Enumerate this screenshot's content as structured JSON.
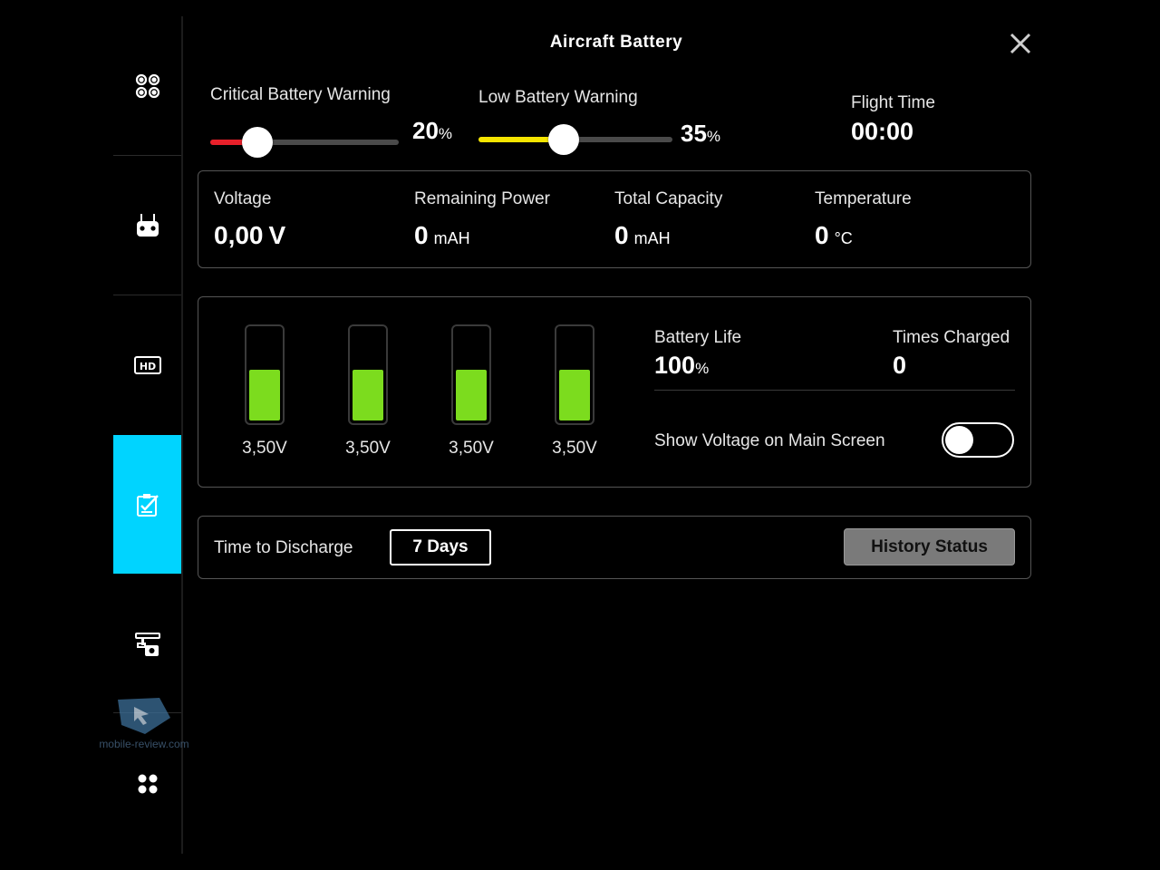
{
  "title": "Aircraft Battery",
  "sidebar": {
    "items": [
      {
        "icon": "aircraft-icon",
        "active": false
      },
      {
        "icon": "remote-controller-icon",
        "active": false
      },
      {
        "icon": "hd-icon",
        "active": false
      },
      {
        "icon": "battery-checklist-icon",
        "active": true
      },
      {
        "icon": "gimbal-camera-icon",
        "active": false
      },
      {
        "icon": "more-dots-icon",
        "active": false
      }
    ],
    "active_color": "#00d4ff"
  },
  "critical_warning": {
    "label": "Critical Battery Warning",
    "value": "20",
    "unit": "%",
    "level": 0.2,
    "color": "#e8202a"
  },
  "low_warning": {
    "label": "Low Battery Warning",
    "value": "35",
    "unit": "%",
    "level": 0.35,
    "color": "#f5e500"
  },
  "flight_time": {
    "label": "Flight Time",
    "value": "00:00"
  },
  "stats": {
    "voltage": {
      "label": "Voltage",
      "value": "0,00",
      "unit": "V"
    },
    "remaining_power": {
      "label": "Remaining Power",
      "value": "0",
      "unit": "mAH"
    },
    "total_capacity": {
      "label": "Total Capacity",
      "value": "0",
      "unit": "mAH"
    },
    "temperature": {
      "label": "Temperature",
      "value": "0",
      "unit": "°C"
    }
  },
  "cells": [
    {
      "voltage": "3,50V",
      "level": 0.55
    },
    {
      "voltage": "3,50V",
      "level": 0.55
    },
    {
      "voltage": "3,50V",
      "level": 0.55
    },
    {
      "voltage": "3,50V",
      "level": 0.55
    }
  ],
  "battery_life": {
    "label": "Battery Life",
    "value": "100",
    "unit": "%"
  },
  "times_charged": {
    "label": "Times Charged",
    "value": "0"
  },
  "show_voltage": {
    "label": "Show Voltage on Main Screen",
    "enabled": false
  },
  "discharge": {
    "label": "Time to Discharge",
    "value": "7 Days"
  },
  "history_button": "History Status",
  "watermark": "mobile-review.com"
}
